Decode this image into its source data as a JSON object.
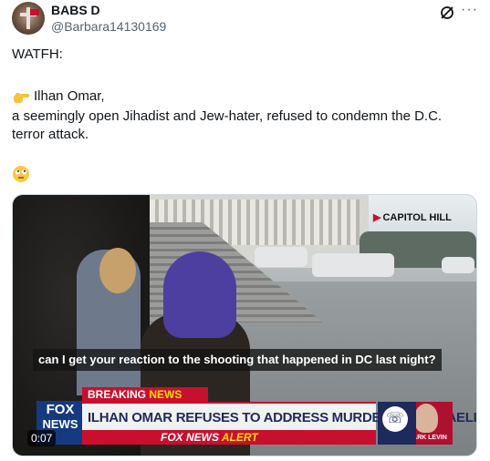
{
  "author": {
    "name": "BABS D",
    "handle": "@Barbara14130169"
  },
  "header_icons": {
    "grok": "grok-icon",
    "more": "···"
  },
  "tweet": {
    "line1": "WATFH:",
    "line2": "Ilhan Omar,",
    "line3": "a seemingly open Jihadist and Jew-hater, refused to condemn the D.C.",
    "line4": "terror attack.",
    "emoji_pointing": "pointing-right-hand",
    "emoji_face": "rolling-eyes-face"
  },
  "video": {
    "location_tag": "CAPITOL HILL",
    "subtitle": "can I get your reaction to the shooting that happened in DC last night?",
    "breaking_label": "BREAKING",
    "breaking_news_word": "NEWS",
    "headline": "ILHAN OMAR REFUSES TO ADDRESS MURDERS OF ISRAELIS",
    "alert_prefix": "FOX NEWS",
    "alert_word": "ALERT",
    "logo_top": "FOX",
    "logo_bottom": "NEWS",
    "host_name": "MARK LEVIN",
    "timestamp": "0:07",
    "colors": {
      "fox_red": "#c8102e",
      "fox_navy": "#1e2a5c",
      "fox_yellow": "#ffde00"
    }
  }
}
